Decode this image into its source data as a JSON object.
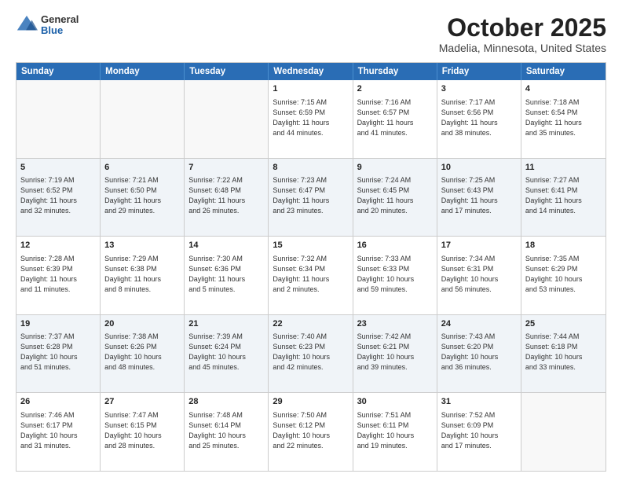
{
  "header": {
    "logo_general": "General",
    "logo_blue": "Blue",
    "title": "October 2025",
    "subtitle": "Madelia, Minnesota, United States"
  },
  "weekdays": [
    "Sunday",
    "Monday",
    "Tuesday",
    "Wednesday",
    "Thursday",
    "Friday",
    "Saturday"
  ],
  "rows": [
    [
      {
        "day": "",
        "info": ""
      },
      {
        "day": "",
        "info": ""
      },
      {
        "day": "",
        "info": ""
      },
      {
        "day": "1",
        "info": "Sunrise: 7:15 AM\nSunset: 6:59 PM\nDaylight: 11 hours\nand 44 minutes."
      },
      {
        "day": "2",
        "info": "Sunrise: 7:16 AM\nSunset: 6:57 PM\nDaylight: 11 hours\nand 41 minutes."
      },
      {
        "day": "3",
        "info": "Sunrise: 7:17 AM\nSunset: 6:56 PM\nDaylight: 11 hours\nand 38 minutes."
      },
      {
        "day": "4",
        "info": "Sunrise: 7:18 AM\nSunset: 6:54 PM\nDaylight: 11 hours\nand 35 minutes."
      }
    ],
    [
      {
        "day": "5",
        "info": "Sunrise: 7:19 AM\nSunset: 6:52 PM\nDaylight: 11 hours\nand 32 minutes."
      },
      {
        "day": "6",
        "info": "Sunrise: 7:21 AM\nSunset: 6:50 PM\nDaylight: 11 hours\nand 29 minutes."
      },
      {
        "day": "7",
        "info": "Sunrise: 7:22 AM\nSunset: 6:48 PM\nDaylight: 11 hours\nand 26 minutes."
      },
      {
        "day": "8",
        "info": "Sunrise: 7:23 AM\nSunset: 6:47 PM\nDaylight: 11 hours\nand 23 minutes."
      },
      {
        "day": "9",
        "info": "Sunrise: 7:24 AM\nSunset: 6:45 PM\nDaylight: 11 hours\nand 20 minutes."
      },
      {
        "day": "10",
        "info": "Sunrise: 7:25 AM\nSunset: 6:43 PM\nDaylight: 11 hours\nand 17 minutes."
      },
      {
        "day": "11",
        "info": "Sunrise: 7:27 AM\nSunset: 6:41 PM\nDaylight: 11 hours\nand 14 minutes."
      }
    ],
    [
      {
        "day": "12",
        "info": "Sunrise: 7:28 AM\nSunset: 6:39 PM\nDaylight: 11 hours\nand 11 minutes."
      },
      {
        "day": "13",
        "info": "Sunrise: 7:29 AM\nSunset: 6:38 PM\nDaylight: 11 hours\nand 8 minutes."
      },
      {
        "day": "14",
        "info": "Sunrise: 7:30 AM\nSunset: 6:36 PM\nDaylight: 11 hours\nand 5 minutes."
      },
      {
        "day": "15",
        "info": "Sunrise: 7:32 AM\nSunset: 6:34 PM\nDaylight: 11 hours\nand 2 minutes."
      },
      {
        "day": "16",
        "info": "Sunrise: 7:33 AM\nSunset: 6:33 PM\nDaylight: 10 hours\nand 59 minutes."
      },
      {
        "day": "17",
        "info": "Sunrise: 7:34 AM\nSunset: 6:31 PM\nDaylight: 10 hours\nand 56 minutes."
      },
      {
        "day": "18",
        "info": "Sunrise: 7:35 AM\nSunset: 6:29 PM\nDaylight: 10 hours\nand 53 minutes."
      }
    ],
    [
      {
        "day": "19",
        "info": "Sunrise: 7:37 AM\nSunset: 6:28 PM\nDaylight: 10 hours\nand 51 minutes."
      },
      {
        "day": "20",
        "info": "Sunrise: 7:38 AM\nSunset: 6:26 PM\nDaylight: 10 hours\nand 48 minutes."
      },
      {
        "day": "21",
        "info": "Sunrise: 7:39 AM\nSunset: 6:24 PM\nDaylight: 10 hours\nand 45 minutes."
      },
      {
        "day": "22",
        "info": "Sunrise: 7:40 AM\nSunset: 6:23 PM\nDaylight: 10 hours\nand 42 minutes."
      },
      {
        "day": "23",
        "info": "Sunrise: 7:42 AM\nSunset: 6:21 PM\nDaylight: 10 hours\nand 39 minutes."
      },
      {
        "day": "24",
        "info": "Sunrise: 7:43 AM\nSunset: 6:20 PM\nDaylight: 10 hours\nand 36 minutes."
      },
      {
        "day": "25",
        "info": "Sunrise: 7:44 AM\nSunset: 6:18 PM\nDaylight: 10 hours\nand 33 minutes."
      }
    ],
    [
      {
        "day": "26",
        "info": "Sunrise: 7:46 AM\nSunset: 6:17 PM\nDaylight: 10 hours\nand 31 minutes."
      },
      {
        "day": "27",
        "info": "Sunrise: 7:47 AM\nSunset: 6:15 PM\nDaylight: 10 hours\nand 28 minutes."
      },
      {
        "day": "28",
        "info": "Sunrise: 7:48 AM\nSunset: 6:14 PM\nDaylight: 10 hours\nand 25 minutes."
      },
      {
        "day": "29",
        "info": "Sunrise: 7:50 AM\nSunset: 6:12 PM\nDaylight: 10 hours\nand 22 minutes."
      },
      {
        "day": "30",
        "info": "Sunrise: 7:51 AM\nSunset: 6:11 PM\nDaylight: 10 hours\nand 19 minutes."
      },
      {
        "day": "31",
        "info": "Sunrise: 7:52 AM\nSunset: 6:09 PM\nDaylight: 10 hours\nand 17 minutes."
      },
      {
        "day": "",
        "info": ""
      }
    ]
  ]
}
